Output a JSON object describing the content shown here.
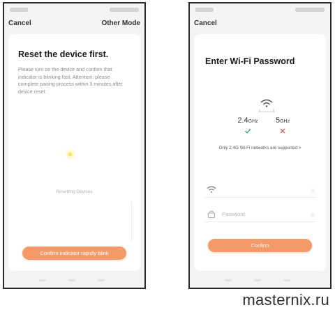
{
  "left_screen": {
    "nav": {
      "cancel_label": "Cancel",
      "other_mode_label": "Other Mode"
    },
    "heading": "Reset the device first.",
    "instructions": "Please turn on the device and confirm that indicator is blinking fast. Attention: please complete pairing process within 3 minutes after device reset",
    "status_text": "Resetting Devices",
    "confirm_label": "Confirm indicator rapidly blink"
  },
  "right_screen": {
    "nav": {
      "cancel_label": "Cancel"
    },
    "heading": "Enter Wi-Fi Password",
    "bands": [
      {
        "value": "2.4",
        "unit": "GHz",
        "supported": true,
        "mark_color": "#3aa564"
      },
      {
        "value": "5",
        "unit": "GHz",
        "supported": false,
        "mark_color": "#e06666"
      }
    ],
    "support_note": "Only 2.4G Wi-Fi networks are supported >",
    "password_placeholder": "Password",
    "confirm_label": "Confirm"
  },
  "colors": {
    "accent": "#f39a68",
    "check": "#3aa564",
    "cross": "#e06666"
  },
  "watermark": "masternix.ru"
}
